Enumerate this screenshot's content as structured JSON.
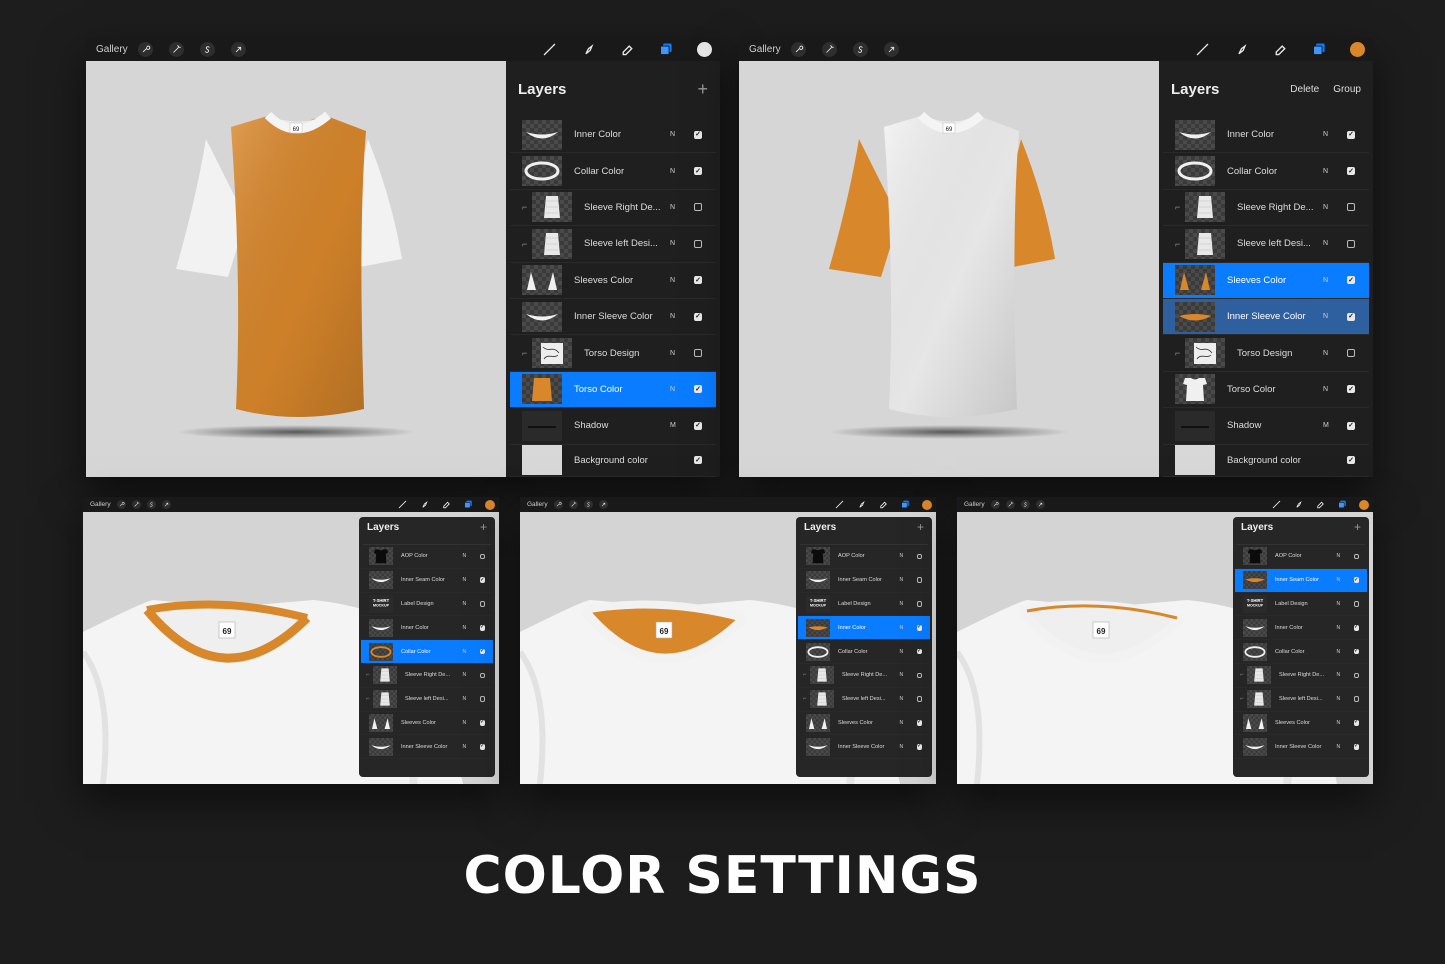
{
  "title": "COLOR SETTINGS",
  "colors": {
    "orange": "#d9872b",
    "white": "#f2f2f2",
    "selected": "#0a7cff",
    "selected_dim": "#2e5f9e"
  },
  "panels": [
    {
      "gallery": "Gallery",
      "swatch": "#e6e6e6",
      "layers_title": "Layers",
      "header_actions": [],
      "has_plus": true,
      "shirt": {
        "torso": "#d9872b",
        "sleeves": "#f2f2f2",
        "collar": "#f4f4f4"
      },
      "rows": [
        {
          "name": "Inner Color",
          "mode": "N",
          "checked": true,
          "thumb": "white-shape",
          "clip": false,
          "state": ""
        },
        {
          "name": "Collar Color",
          "mode": "N",
          "checked": true,
          "thumb": "collar",
          "clip": false,
          "state": ""
        },
        {
          "name": "Sleeve Right De...",
          "mode": "N",
          "checked": false,
          "thumb": "sleeve",
          "clip": true,
          "state": ""
        },
        {
          "name": "Sleeve left Desi...",
          "mode": "N",
          "checked": false,
          "thumb": "sleeve",
          "clip": true,
          "state": ""
        },
        {
          "name": "Sleeves Color",
          "mode": "N",
          "checked": true,
          "thumb": "sleeves-white",
          "clip": false,
          "state": ""
        },
        {
          "name": "Inner Sleeve Color",
          "mode": "N",
          "checked": true,
          "thumb": "white-shape",
          "clip": false,
          "state": ""
        },
        {
          "name": "Torso Design",
          "mode": "N",
          "checked": false,
          "thumb": "design",
          "clip": true,
          "state": ""
        },
        {
          "name": "Torso Color",
          "mode": "N",
          "checked": true,
          "thumb": "torso-orange",
          "clip": false,
          "state": "sel"
        },
        {
          "name": "Shadow",
          "mode": "M",
          "checked": true,
          "thumb": "shadow",
          "clip": false,
          "state": ""
        },
        {
          "name": "Background color",
          "mode": "",
          "checked": true,
          "thumb": "bg",
          "clip": false,
          "state": ""
        }
      ]
    },
    {
      "gallery": "Gallery",
      "swatch": "#d9872b",
      "layers_title": "Layers",
      "header_actions": [
        "Delete",
        "Group"
      ],
      "has_plus": false,
      "shirt": {
        "torso": "#f2f2f2",
        "sleeves": "#d9872b",
        "collar": "#f4f4f4"
      },
      "rows": [
        {
          "name": "Inner Color",
          "mode": "N",
          "checked": true,
          "thumb": "white-shape",
          "clip": false,
          "state": ""
        },
        {
          "name": "Collar Color",
          "mode": "N",
          "checked": true,
          "thumb": "collar",
          "clip": false,
          "state": ""
        },
        {
          "name": "Sleeve Right De...",
          "mode": "N",
          "checked": false,
          "thumb": "sleeve",
          "clip": true,
          "state": ""
        },
        {
          "name": "Sleeve left Desi...",
          "mode": "N",
          "checked": false,
          "thumb": "sleeve",
          "clip": true,
          "state": ""
        },
        {
          "name": "Sleeves Color",
          "mode": "N",
          "checked": true,
          "thumb": "sleeves-orange",
          "clip": false,
          "state": "sel"
        },
        {
          "name": "Inner Sleeve Color",
          "mode": "N",
          "checked": true,
          "thumb": "orange-shape",
          "clip": false,
          "state": "sel2"
        },
        {
          "name": "Torso Design",
          "mode": "N",
          "checked": false,
          "thumb": "design",
          "clip": true,
          "state": ""
        },
        {
          "name": "Torso Color",
          "mode": "N",
          "checked": true,
          "thumb": "torso-white",
          "clip": false,
          "state": ""
        },
        {
          "name": "Shadow",
          "mode": "M",
          "checked": true,
          "thumb": "shadow",
          "clip": false,
          "state": ""
        },
        {
          "name": "Background color",
          "mode": "",
          "checked": true,
          "thumb": "bg",
          "clip": false,
          "state": ""
        }
      ]
    },
    {
      "gallery": "Gallery",
      "swatch": "#d9872b",
      "layers_title": "Layers",
      "header_actions": [],
      "has_plus": true,
      "collar_mode": "collar",
      "rows": [
        {
          "name": "AOP Color",
          "mode": "N",
          "checked": false,
          "thumb": "black-shirt",
          "clip": false,
          "state": ""
        },
        {
          "name": "Inner Seam Color",
          "mode": "N",
          "checked": true,
          "thumb": "white-shape",
          "clip": false,
          "state": ""
        },
        {
          "name": "Label Design",
          "mode": "N",
          "checked": false,
          "thumb": "label",
          "clip": false,
          "state": ""
        },
        {
          "name": "Inner Color",
          "mode": "N",
          "checked": true,
          "thumb": "white-shape",
          "clip": false,
          "state": ""
        },
        {
          "name": "Collar Color",
          "mode": "N",
          "checked": true,
          "thumb": "collar-orange",
          "clip": false,
          "state": "sel"
        },
        {
          "name": "Sleeve Right De...",
          "mode": "N",
          "checked": false,
          "thumb": "sleeve",
          "clip": true,
          "state": ""
        },
        {
          "name": "Sleeve left Desi...",
          "mode": "N",
          "checked": false,
          "thumb": "sleeve",
          "clip": true,
          "state": ""
        },
        {
          "name": "Sleeves Color",
          "mode": "N",
          "checked": true,
          "thumb": "sleeves-white",
          "clip": false,
          "state": ""
        },
        {
          "name": "Inner Sleeve Color",
          "mode": "N",
          "checked": true,
          "thumb": "white-shape",
          "clip": false,
          "state": ""
        }
      ]
    },
    {
      "gallery": "Gallery",
      "swatch": "#d9872b",
      "layers_title": "Layers",
      "header_actions": [],
      "has_plus": true,
      "collar_mode": "inner",
      "rows": [
        {
          "name": "AOP Color",
          "mode": "N",
          "checked": false,
          "thumb": "black-shirt",
          "clip": false,
          "state": ""
        },
        {
          "name": "Inner Seam Color",
          "mode": "N",
          "checked": false,
          "thumb": "white-shape",
          "clip": false,
          "state": ""
        },
        {
          "name": "Label Design",
          "mode": "N",
          "checked": false,
          "thumb": "label",
          "clip": false,
          "state": ""
        },
        {
          "name": "Inner Color",
          "mode": "N",
          "checked": true,
          "thumb": "orange-shape",
          "clip": false,
          "state": "sel"
        },
        {
          "name": "Collar Color",
          "mode": "N",
          "checked": true,
          "thumb": "collar",
          "clip": false,
          "state": ""
        },
        {
          "name": "Sleeve Right De...",
          "mode": "N",
          "checked": false,
          "thumb": "sleeve",
          "clip": true,
          "state": ""
        },
        {
          "name": "Sleeve left Desi...",
          "mode": "N",
          "checked": false,
          "thumb": "sleeve",
          "clip": true,
          "state": ""
        },
        {
          "name": "Sleeves Color",
          "mode": "N",
          "checked": true,
          "thumb": "sleeves-white",
          "clip": false,
          "state": ""
        },
        {
          "name": "Inner Sleeve Color",
          "mode": "N",
          "checked": true,
          "thumb": "white-shape",
          "clip": false,
          "state": ""
        }
      ]
    },
    {
      "gallery": "Gallery",
      "swatch": "#d9872b",
      "layers_title": "Layers",
      "header_actions": [],
      "has_plus": true,
      "collar_mode": "seam",
      "rows": [
        {
          "name": "AOP Color",
          "mode": "N",
          "checked": false,
          "thumb": "black-shirt",
          "clip": false,
          "state": ""
        },
        {
          "name": "Inner Seam Color",
          "mode": "N",
          "checked": true,
          "thumb": "orange-shape",
          "clip": false,
          "state": "sel"
        },
        {
          "name": "Label Design",
          "mode": "N",
          "checked": false,
          "thumb": "label",
          "clip": false,
          "state": ""
        },
        {
          "name": "Inner Color",
          "mode": "N",
          "checked": true,
          "thumb": "white-shape",
          "clip": false,
          "state": ""
        },
        {
          "name": "Collar Color",
          "mode": "N",
          "checked": true,
          "thumb": "collar",
          "clip": false,
          "state": ""
        },
        {
          "name": "Sleeve Right De...",
          "mode": "N",
          "checked": false,
          "thumb": "sleeve",
          "clip": true,
          "state": ""
        },
        {
          "name": "Sleeve left Desi...",
          "mode": "N",
          "checked": false,
          "thumb": "sleeve",
          "clip": true,
          "state": ""
        },
        {
          "name": "Sleeves Color",
          "mode": "N",
          "checked": true,
          "thumb": "sleeves-white",
          "clip": false,
          "state": ""
        },
        {
          "name": "Inner Sleeve Color",
          "mode": "N",
          "checked": true,
          "thumb": "white-shape",
          "clip": false,
          "state": ""
        }
      ]
    }
  ]
}
